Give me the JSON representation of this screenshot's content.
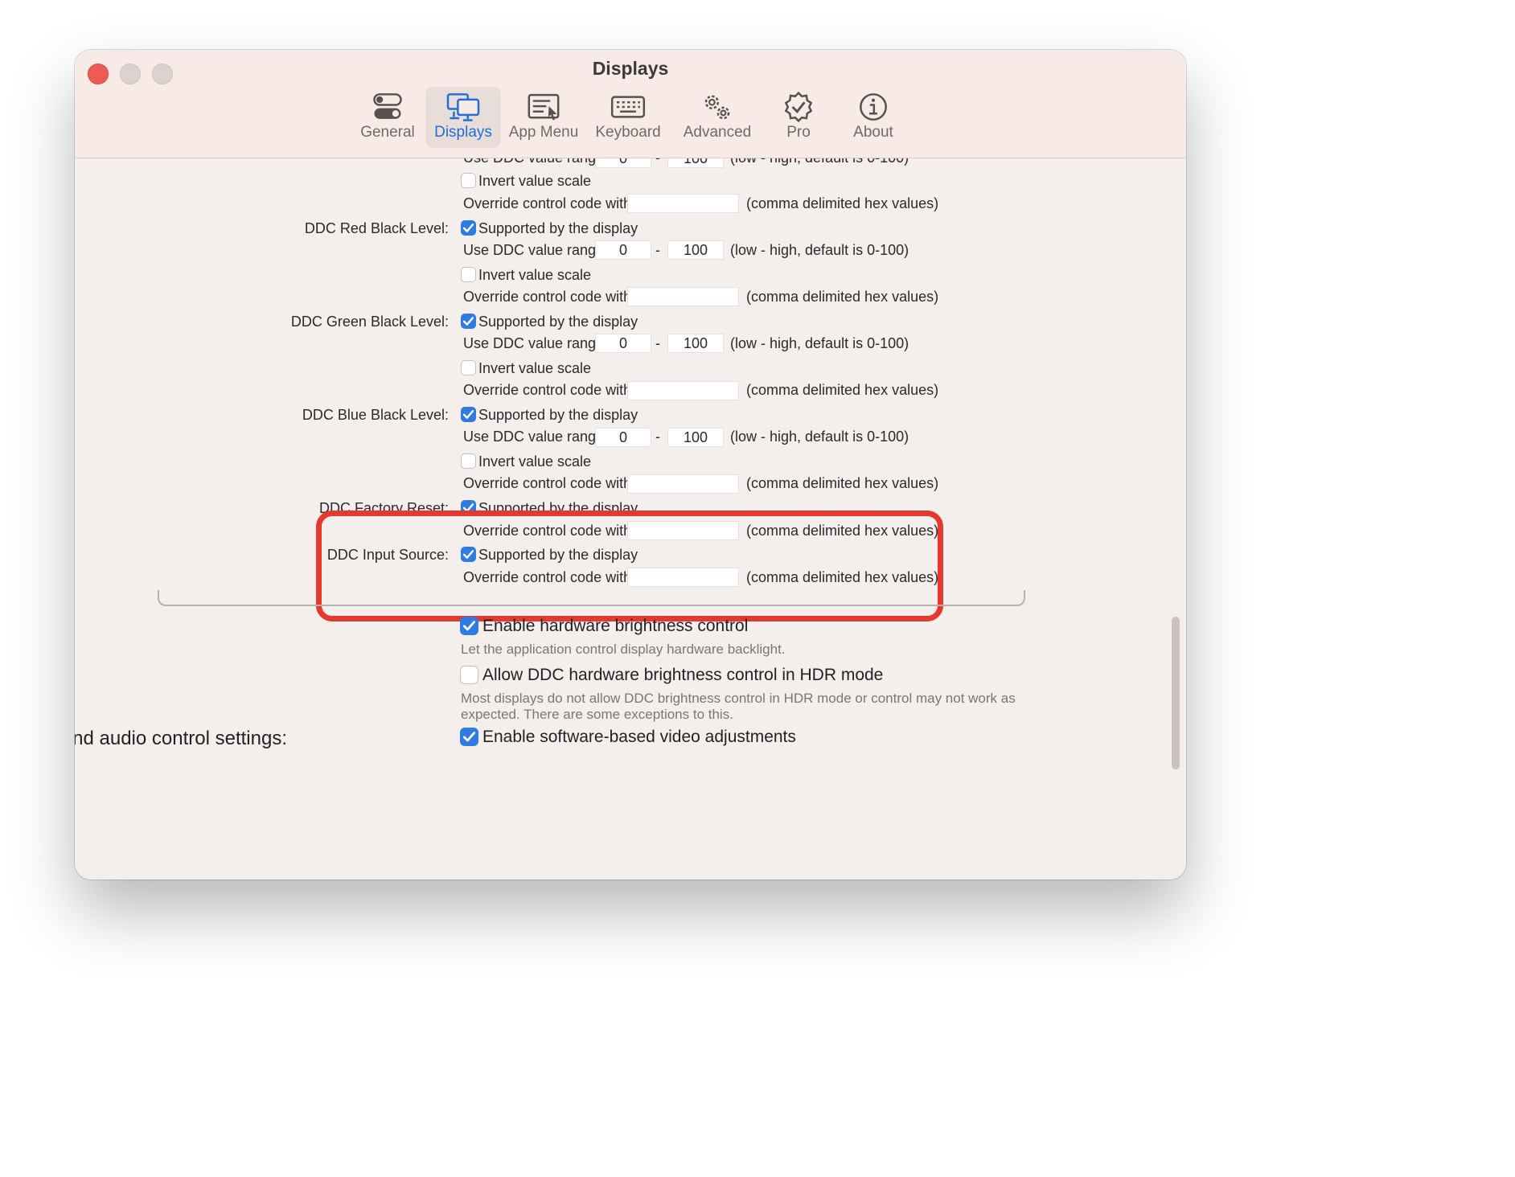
{
  "window": {
    "title": "Displays"
  },
  "toolbar": {
    "tabs": [
      {
        "label": "General",
        "icon": "toggle-icon"
      },
      {
        "label": "Displays",
        "icon": "displays-icon"
      },
      {
        "label": "App Menu",
        "icon": "app-menu-icon"
      },
      {
        "label": "Keyboard",
        "icon": "keyboard-icon"
      },
      {
        "label": "Advanced",
        "icon": "gears-icon"
      },
      {
        "label": "Pro",
        "icon": "badge-check-icon"
      },
      {
        "label": "About",
        "icon": "info-icon"
      }
    ],
    "active": "Displays"
  },
  "common": {
    "supported": "Supported by the display",
    "use_range": "Use DDC value range",
    "dash": "-",
    "range_hint": "(low - high, default is 0-100)",
    "invert": "Invert value scale",
    "override": "Override control code with",
    "override_hint": "(comma delimited hex values)"
  },
  "top_partial": {
    "range_low": "0",
    "range_high": "100",
    "invert_checked": false,
    "override_value": ""
  },
  "controls": [
    {
      "label": "DDC Red Black Level:",
      "supported": true,
      "range_low": "0",
      "range_high": "100",
      "invert_checked": false,
      "override_value": ""
    },
    {
      "label": "DDC Green Black Level:",
      "supported": true,
      "range_low": "0",
      "range_high": "100",
      "invert_checked": false,
      "override_value": ""
    },
    {
      "label": "DDC Blue Black Level:",
      "supported": true,
      "range_low": "0",
      "range_high": "100",
      "invert_checked": false,
      "override_value": ""
    },
    {
      "label": "DDC Factory Reset:",
      "supported": true,
      "override_value": ""
    },
    {
      "label": "DDC Input Source:",
      "supported": true,
      "override_value": ""
    }
  ],
  "settings": {
    "hw_brightness": {
      "label": "Enable hardware brightness control",
      "checked": true,
      "note": "Let the application control display hardware backlight."
    },
    "hdr_brightness": {
      "label": "Allow DDC hardware brightness control in HDR mode",
      "checked": false,
      "note_line1": "Most displays do not allow DDC brightness control in HDR mode or control may not work as",
      "note_line2": "expected. There are some exceptions to this."
    },
    "video_audio": {
      "section_label": "Video and audio control settings:",
      "label": "Enable software-based video adjustments",
      "checked": true
    }
  },
  "colors": {
    "accent": "#2f7be6",
    "highlight_border": "#e4392c",
    "close_button": "#ee5b53"
  }
}
